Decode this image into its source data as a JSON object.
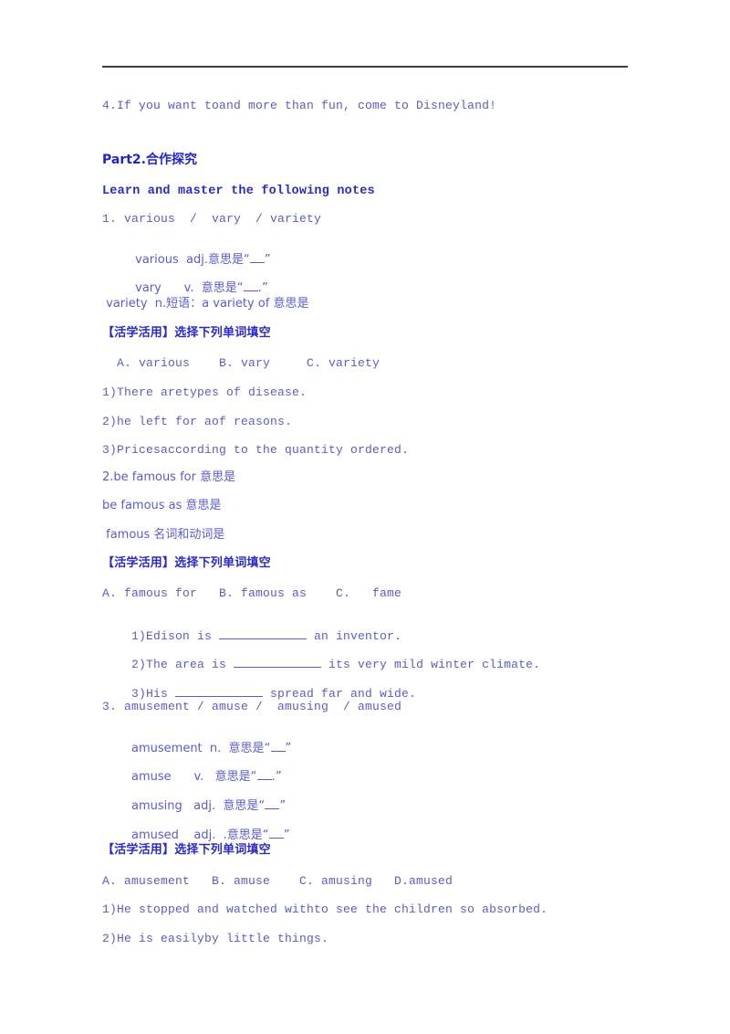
{
  "document": {
    "colors": {
      "body_text": "#5b5bd0",
      "heading_text": "#2323c8",
      "rule": "#3c3c41",
      "background": "#ffffff"
    }
  },
  "content": {
    "item4": "4.If you want toand more than fun, come to Disneyland!",
    "part2_heading": "Part2.合作探究",
    "notes_heading": "Learn and master the following notes",
    "word1": {
      "title": "1. various  /  vary  / variety",
      "various_line_a": " various  adj.意思是",
      "various_quote_open": "“",
      "various_quote_close": "”",
      "vary_line_a": " vary      v.  意思是",
      "vary_quote_open": "“",
      "vary_mid": ".",
      "vary_quote_close": "”",
      "variety_line": " variety  n.短语：a variety of 意思是",
      "apply_label": "【活学活用】选择下列单词填空",
      "options": "  A. various    B. vary     C. variety",
      "q1": "1)There aretypes of disease.",
      "q2": "2)he left for aof reasons.",
      "q3": "3)Pricesaccording to the quantity ordered."
    },
    "word2": {
      "title": "2.be famous for 意思是",
      "as_line": "be famous as 意思是",
      "noun_line": " famous 名词和动词是",
      "apply_label": "【活学活用】选择下列单词填空",
      "options": "A. famous for   B. famous as    C.   fame",
      "q1_before": "1)Edison is ",
      "q1_after": " an inventor.",
      "q2_before": "2)The area is ",
      "q2_after": " its very mild winter climate.",
      "q3_before": "3)His ",
      "q3_after": " spread far and wide."
    },
    "word3": {
      "title": "3. amusement / amuse /  amusing  / amused",
      "amusement_line": "amusement  n.  意思是",
      "amusement_quote_open": "“",
      "amusement_quote_close": "”",
      "amuse_line": "amuse      v.   意思是",
      "amuse_quote_open": "“",
      "amuse_mid": ".",
      "amuse_quote_close": "”",
      "amusing_line": "amusing   adj.  意思是",
      "amusing_quote_open": "“",
      "amusing_quote_close": "”",
      "amused_line": "amused    adj.  .意思是",
      "amused_quote_open": "“",
      "amused_quote_close": "”",
      "apply_label": "【活学活用】选择下列单词填空",
      "options": "A. amusement   B. amuse    C. amusing   D.amused",
      "q1": "1)He stopped and watched withto see the children so absorbed.",
      "q2": "2)He is easilyby little things."
    }
  }
}
